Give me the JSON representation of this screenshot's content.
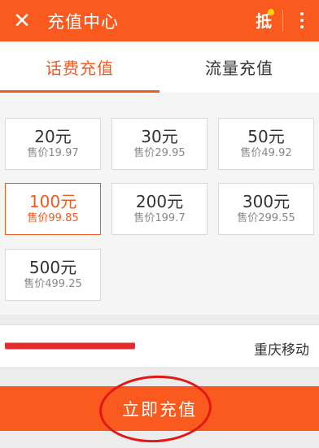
{
  "header": {
    "title": "充值中心",
    "close_icon": "close-icon",
    "badge_icon": "coupon-icon",
    "badge_text": "抵",
    "more_icon": "more-vertical-icon"
  },
  "tabs": [
    {
      "label": "话费充值",
      "active": true
    },
    {
      "label": "流量充值",
      "active": false
    }
  ],
  "options": [
    {
      "amount": "20元",
      "price": "售价19.97",
      "selected": false
    },
    {
      "amount": "30元",
      "price": "售价29.95",
      "selected": false
    },
    {
      "amount": "50元",
      "price": "售价49.92",
      "selected": false
    },
    {
      "amount": "100元",
      "price": "售价99.85",
      "selected": true
    },
    {
      "amount": "200元",
      "price": "售价199.7",
      "selected": false
    },
    {
      "amount": "300元",
      "price": "售价299.55",
      "selected": false
    },
    {
      "amount": "500元",
      "price": "售价499.25",
      "selected": false
    }
  ],
  "phone": {
    "value": "",
    "carrier": "重庆移动"
  },
  "action": {
    "recharge_label": "立即充值"
  },
  "colors": {
    "brand": "#fa5a1e",
    "accent": "#f15a22",
    "annotation": "#e01818"
  }
}
